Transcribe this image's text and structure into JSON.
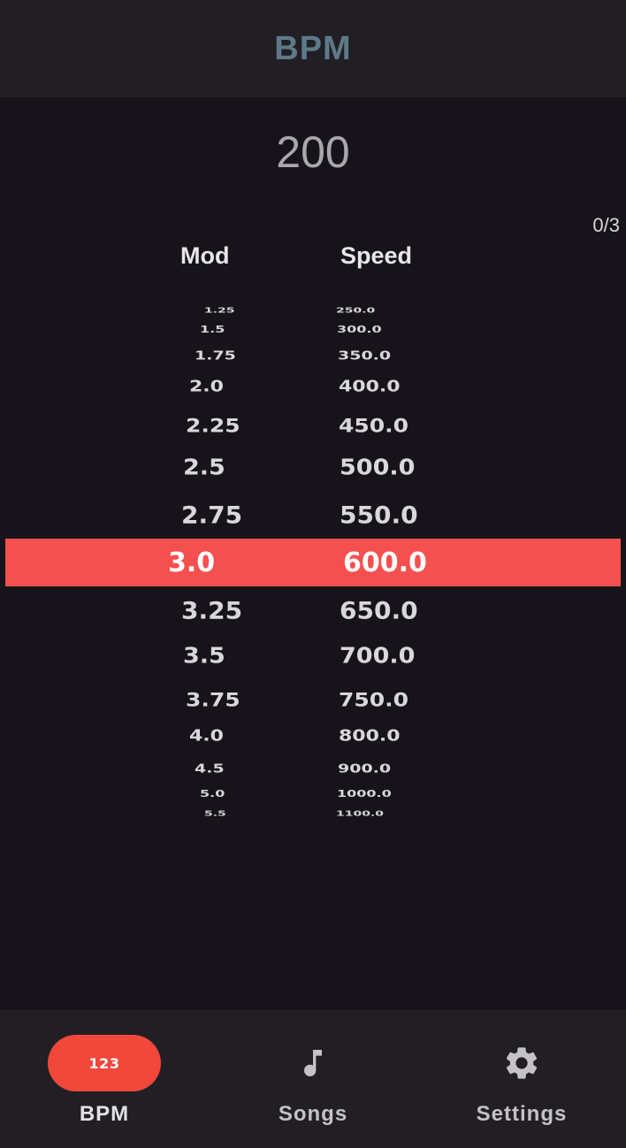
{
  "app_bar": {
    "title": "BPM"
  },
  "bpm": {
    "value": "200"
  },
  "counter": "0/3",
  "columns": {
    "mod": "Mod",
    "speed": "Speed"
  },
  "wheel": {
    "selected_index": 7,
    "rows": [
      {
        "mod": "1.25",
        "speed": "250.0"
      },
      {
        "mod": "1.5",
        "speed": "300.0"
      },
      {
        "mod": "1.75",
        "speed": "350.0"
      },
      {
        "mod": "2.0",
        "speed": "400.0"
      },
      {
        "mod": "2.25",
        "speed": "450.0"
      },
      {
        "mod": "2.5",
        "speed": "500.0"
      },
      {
        "mod": "2.75",
        "speed": "550.0"
      },
      {
        "mod": "3.0",
        "speed": "600.0"
      },
      {
        "mod": "3.25",
        "speed": "650.0"
      },
      {
        "mod": "3.5",
        "speed": "700.0"
      },
      {
        "mod": "3.75",
        "speed": "750.0"
      },
      {
        "mod": "4.0",
        "speed": "800.0"
      },
      {
        "mod": "4.5",
        "speed": "900.0"
      },
      {
        "mod": "5.0",
        "speed": "1000.0"
      },
      {
        "mod": "5.5",
        "speed": "1100.0"
      }
    ]
  },
  "nav": {
    "bpm": {
      "label": "BPM",
      "icon": "numbers-icon",
      "icon_text": "123"
    },
    "songs": {
      "label": "Songs",
      "icon": "music-note-icon"
    },
    "settings": {
      "label": "Settings",
      "icon": "gear-icon"
    }
  },
  "colors": {
    "accent": "#f55050",
    "nav_active": "#f2473b",
    "title": "#5f7a87",
    "background": "#16141a",
    "surface": "#211f24"
  }
}
